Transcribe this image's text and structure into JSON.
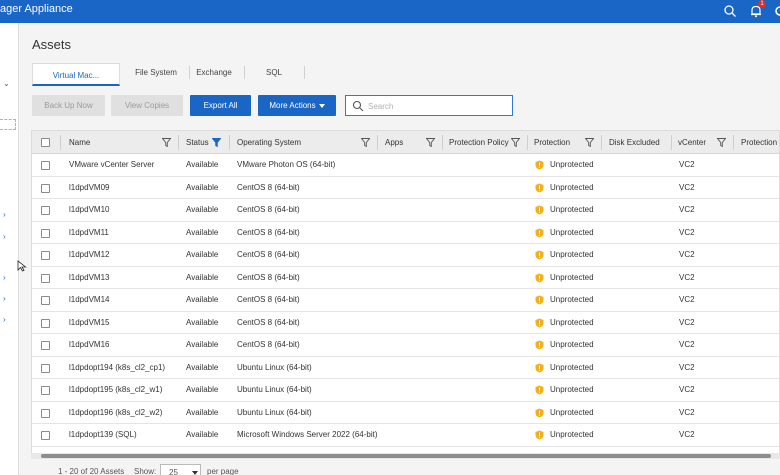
{
  "app": {
    "title": "ager Appliance",
    "notification_count": "1"
  },
  "page": {
    "title": "Assets"
  },
  "tabs": [
    {
      "label": "Virtual Mac..."
    },
    {
      "label": "File System"
    },
    {
      "label": "Exchange"
    },
    {
      "label": "SQL"
    }
  ],
  "toolbar": {
    "backup_label": "Back Up Now",
    "view_copies_label": "View Copies",
    "export_label": "Export All",
    "more_actions_label": "More Actions",
    "search_placeholder": "Search"
  },
  "table": {
    "columns": [
      "Name",
      "Status",
      "Operating System",
      "Apps",
      "Protection Policy",
      "Protection",
      "Disk Excluded",
      "vCenter",
      "Protection M"
    ],
    "rows": [
      {
        "name": "VMware vCenter Server",
        "status": "Available",
        "os": "VMware Photon OS (64-bit)",
        "protection": "Unprotected",
        "vcenter": "VC2"
      },
      {
        "name": "l1dpdVM09",
        "status": "Available",
        "os": "CentOS 8 (64-bit)",
        "protection": "Unprotected",
        "vcenter": "VC2"
      },
      {
        "name": "l1dpdVM10",
        "status": "Available",
        "os": "CentOS 8 (64-bit)",
        "protection": "Unprotected",
        "vcenter": "VC2"
      },
      {
        "name": "l1dpdVM11",
        "status": "Available",
        "os": "CentOS 8 (64-bit)",
        "protection": "Unprotected",
        "vcenter": "VC2"
      },
      {
        "name": "l1dpdVM12",
        "status": "Available",
        "os": "CentOS 8 (64-bit)",
        "protection": "Unprotected",
        "vcenter": "VC2"
      },
      {
        "name": "l1dpdVM13",
        "status": "Available",
        "os": "CentOS 8 (64-bit)",
        "protection": "Unprotected",
        "vcenter": "VC2"
      },
      {
        "name": "l1dpdVM14",
        "status": "Available",
        "os": "CentOS 8 (64-bit)",
        "protection": "Unprotected",
        "vcenter": "VC2"
      },
      {
        "name": "l1dpdVM15",
        "status": "Available",
        "os": "CentOS 8 (64-bit)",
        "protection": "Unprotected",
        "vcenter": "VC2"
      },
      {
        "name": "l1dpdVM16",
        "status": "Available",
        "os": "CentOS 8 (64-bit)",
        "protection": "Unprotected",
        "vcenter": "VC2"
      },
      {
        "name": "l1dpdopt194 (k8s_cl2_cp1)",
        "status": "Available",
        "os": "Ubuntu Linux (64-bit)",
        "protection": "Unprotected",
        "vcenter": "VC2"
      },
      {
        "name": "l1dpdopt195 (k8s_cl2_w1)",
        "status": "Available",
        "os": "Ubuntu Linux (64-bit)",
        "protection": "Unprotected",
        "vcenter": "VC2"
      },
      {
        "name": "l1dpdopt196 (k8s_cl2_w2)",
        "status": "Available",
        "os": "Ubuntu Linux (64-bit)",
        "protection": "Unprotected",
        "vcenter": "VC2"
      },
      {
        "name": "l1dpdopt139 (SQL)",
        "status": "Available",
        "os": "Microsoft Windows Server 2022 (64-bit)",
        "protection": "Unprotected",
        "vcenter": "VC2"
      }
    ]
  },
  "footer": {
    "range_text": "1 - 20 of 20 Assets",
    "show_label": "Show:",
    "page_size": "25",
    "per_page_label": "per page"
  },
  "colors": {
    "accent": "#1a66c6",
    "shield": "#f2b01e",
    "header_bg": "#ececec"
  }
}
